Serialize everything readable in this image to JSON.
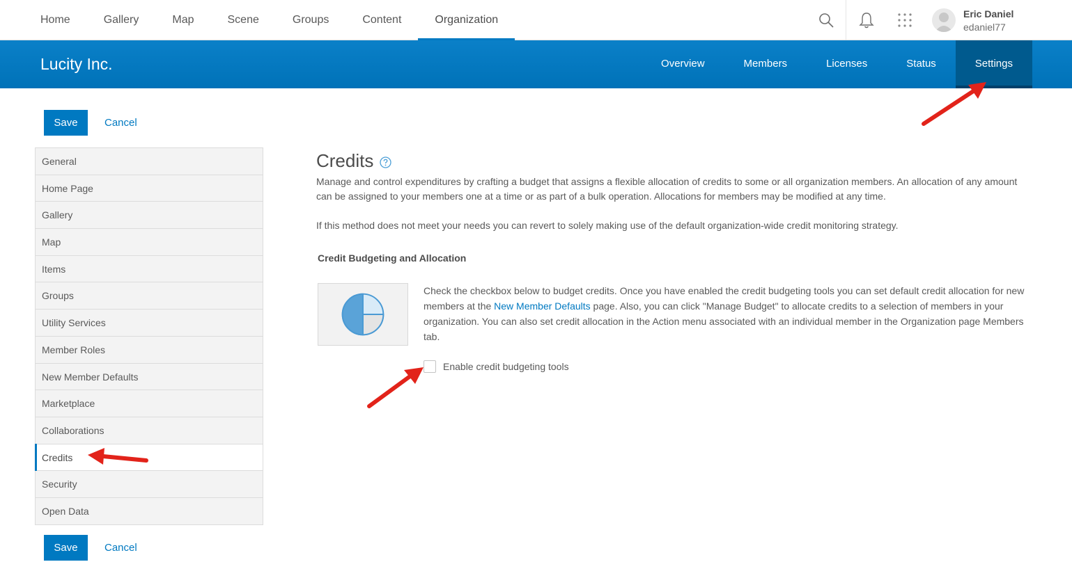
{
  "topnav": {
    "links": [
      "Home",
      "Gallery",
      "Map",
      "Scene",
      "Groups",
      "Content",
      "Organization"
    ],
    "active": "Organization",
    "user": {
      "name": "Eric Daniel",
      "username": "edaniel77"
    }
  },
  "orgbar": {
    "org_name": "Lucity Inc.",
    "tabs": [
      "Overview",
      "Members",
      "Licenses",
      "Status",
      "Settings"
    ],
    "active": "Settings"
  },
  "actions": {
    "save_label": "Save",
    "cancel_label": "Cancel"
  },
  "sidemenu": {
    "items": [
      "General",
      "Home Page",
      "Gallery",
      "Map",
      "Items",
      "Groups",
      "Utility Services",
      "Member Roles",
      "New Member Defaults",
      "Marketplace",
      "Collaborations",
      "Credits",
      "Security",
      "Open Data"
    ],
    "active": "Credits"
  },
  "content": {
    "title": "Credits",
    "description": "Manage and control expenditures by crafting a budget that assigns a flexible allocation of credits to some or all organization members. An allocation of any amount can be assigned to your members one at a time or as part of a bulk operation. Allocations for members may be modified at any time.",
    "description2": "If this method does not meet your needs you can revert to solely making use of the default organization-wide credit monitoring strategy.",
    "section_heading": "Credit Budgeting and Allocation",
    "para_before_link": "Check the checkbox below to budget credits. Once you have enabled the credit budgeting tools you can set default credit allocation for new members at the ",
    "para_link": "New Member Defaults",
    "para_after_link": " page. Also, you can click \"Manage Budget\" to allocate credits to a selection of members in your organization. You can also set credit allocation in the Action menu associated with an individual member in the Organization page Members tab.",
    "checkbox_label": "Enable credit budgeting tools",
    "checkbox_checked": false
  },
  "colors": {
    "accent": "#0079c1",
    "header_active": "#005a8e",
    "annotation_arrow": "#e2231a"
  }
}
